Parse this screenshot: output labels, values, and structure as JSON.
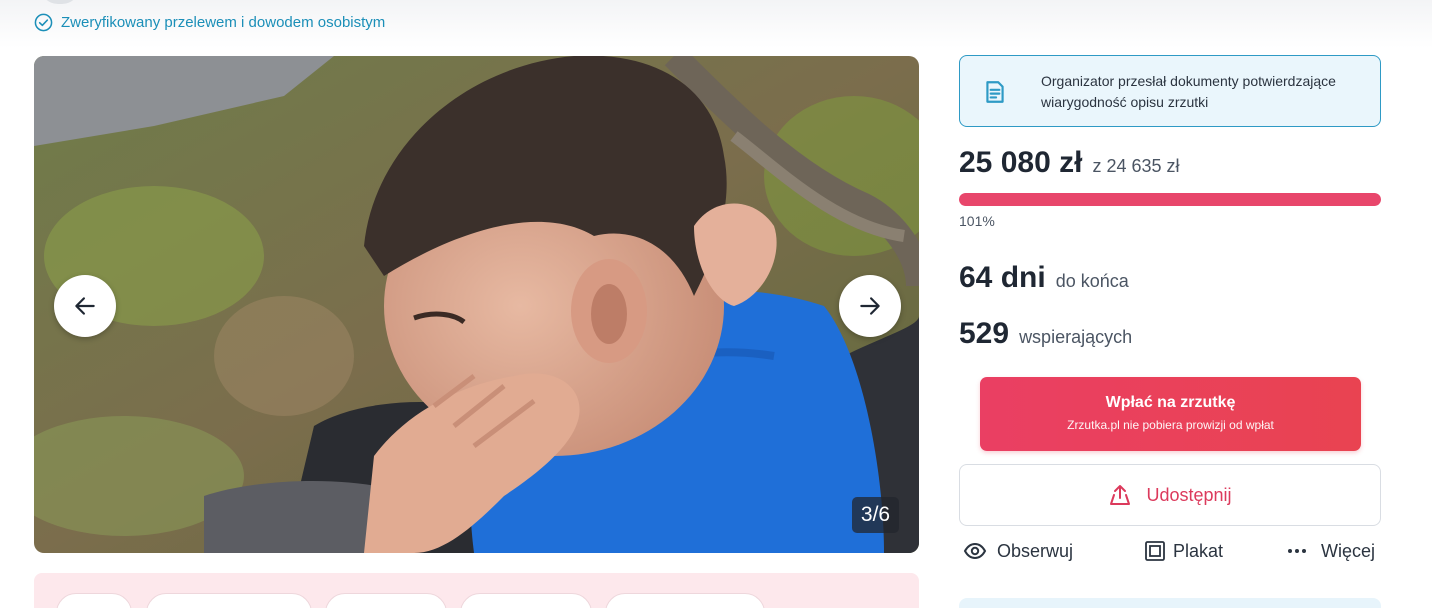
{
  "verified": {
    "text": "Zweryfikowany przelewem i dowodem osobistym",
    "icon": "check-circle-icon"
  },
  "gallery": {
    "counter": "3/6",
    "prev_icon": "arrow-left-icon",
    "next_icon": "arrow-right-icon"
  },
  "info_box": {
    "icon": "document-icon",
    "text": "Organizator przesłał dokumenty potwierdzające wiarygodność opisu zrzutki"
  },
  "fundraiser": {
    "raised": "25 080 zł",
    "goal": "z 24 635 zł",
    "progress_fraction": 1.0,
    "percent": "101%",
    "days_num": "64 dni",
    "days_label": "do końca",
    "supporters_num": "529",
    "supporters_label": "wspierających"
  },
  "donate": {
    "label": "Wpłać na zrzutkę",
    "sublabel": "Zrzutka.pl nie pobiera prowizji od wpłat"
  },
  "share": {
    "label": "Udostępnij",
    "icon": "share-icon"
  },
  "actions": {
    "watch": "Obserwuj",
    "poster": "Plakat",
    "more": "Więcej"
  },
  "colors": {
    "accent": "#e94266",
    "info": "#2e9ac5",
    "text": "#1f2733"
  }
}
